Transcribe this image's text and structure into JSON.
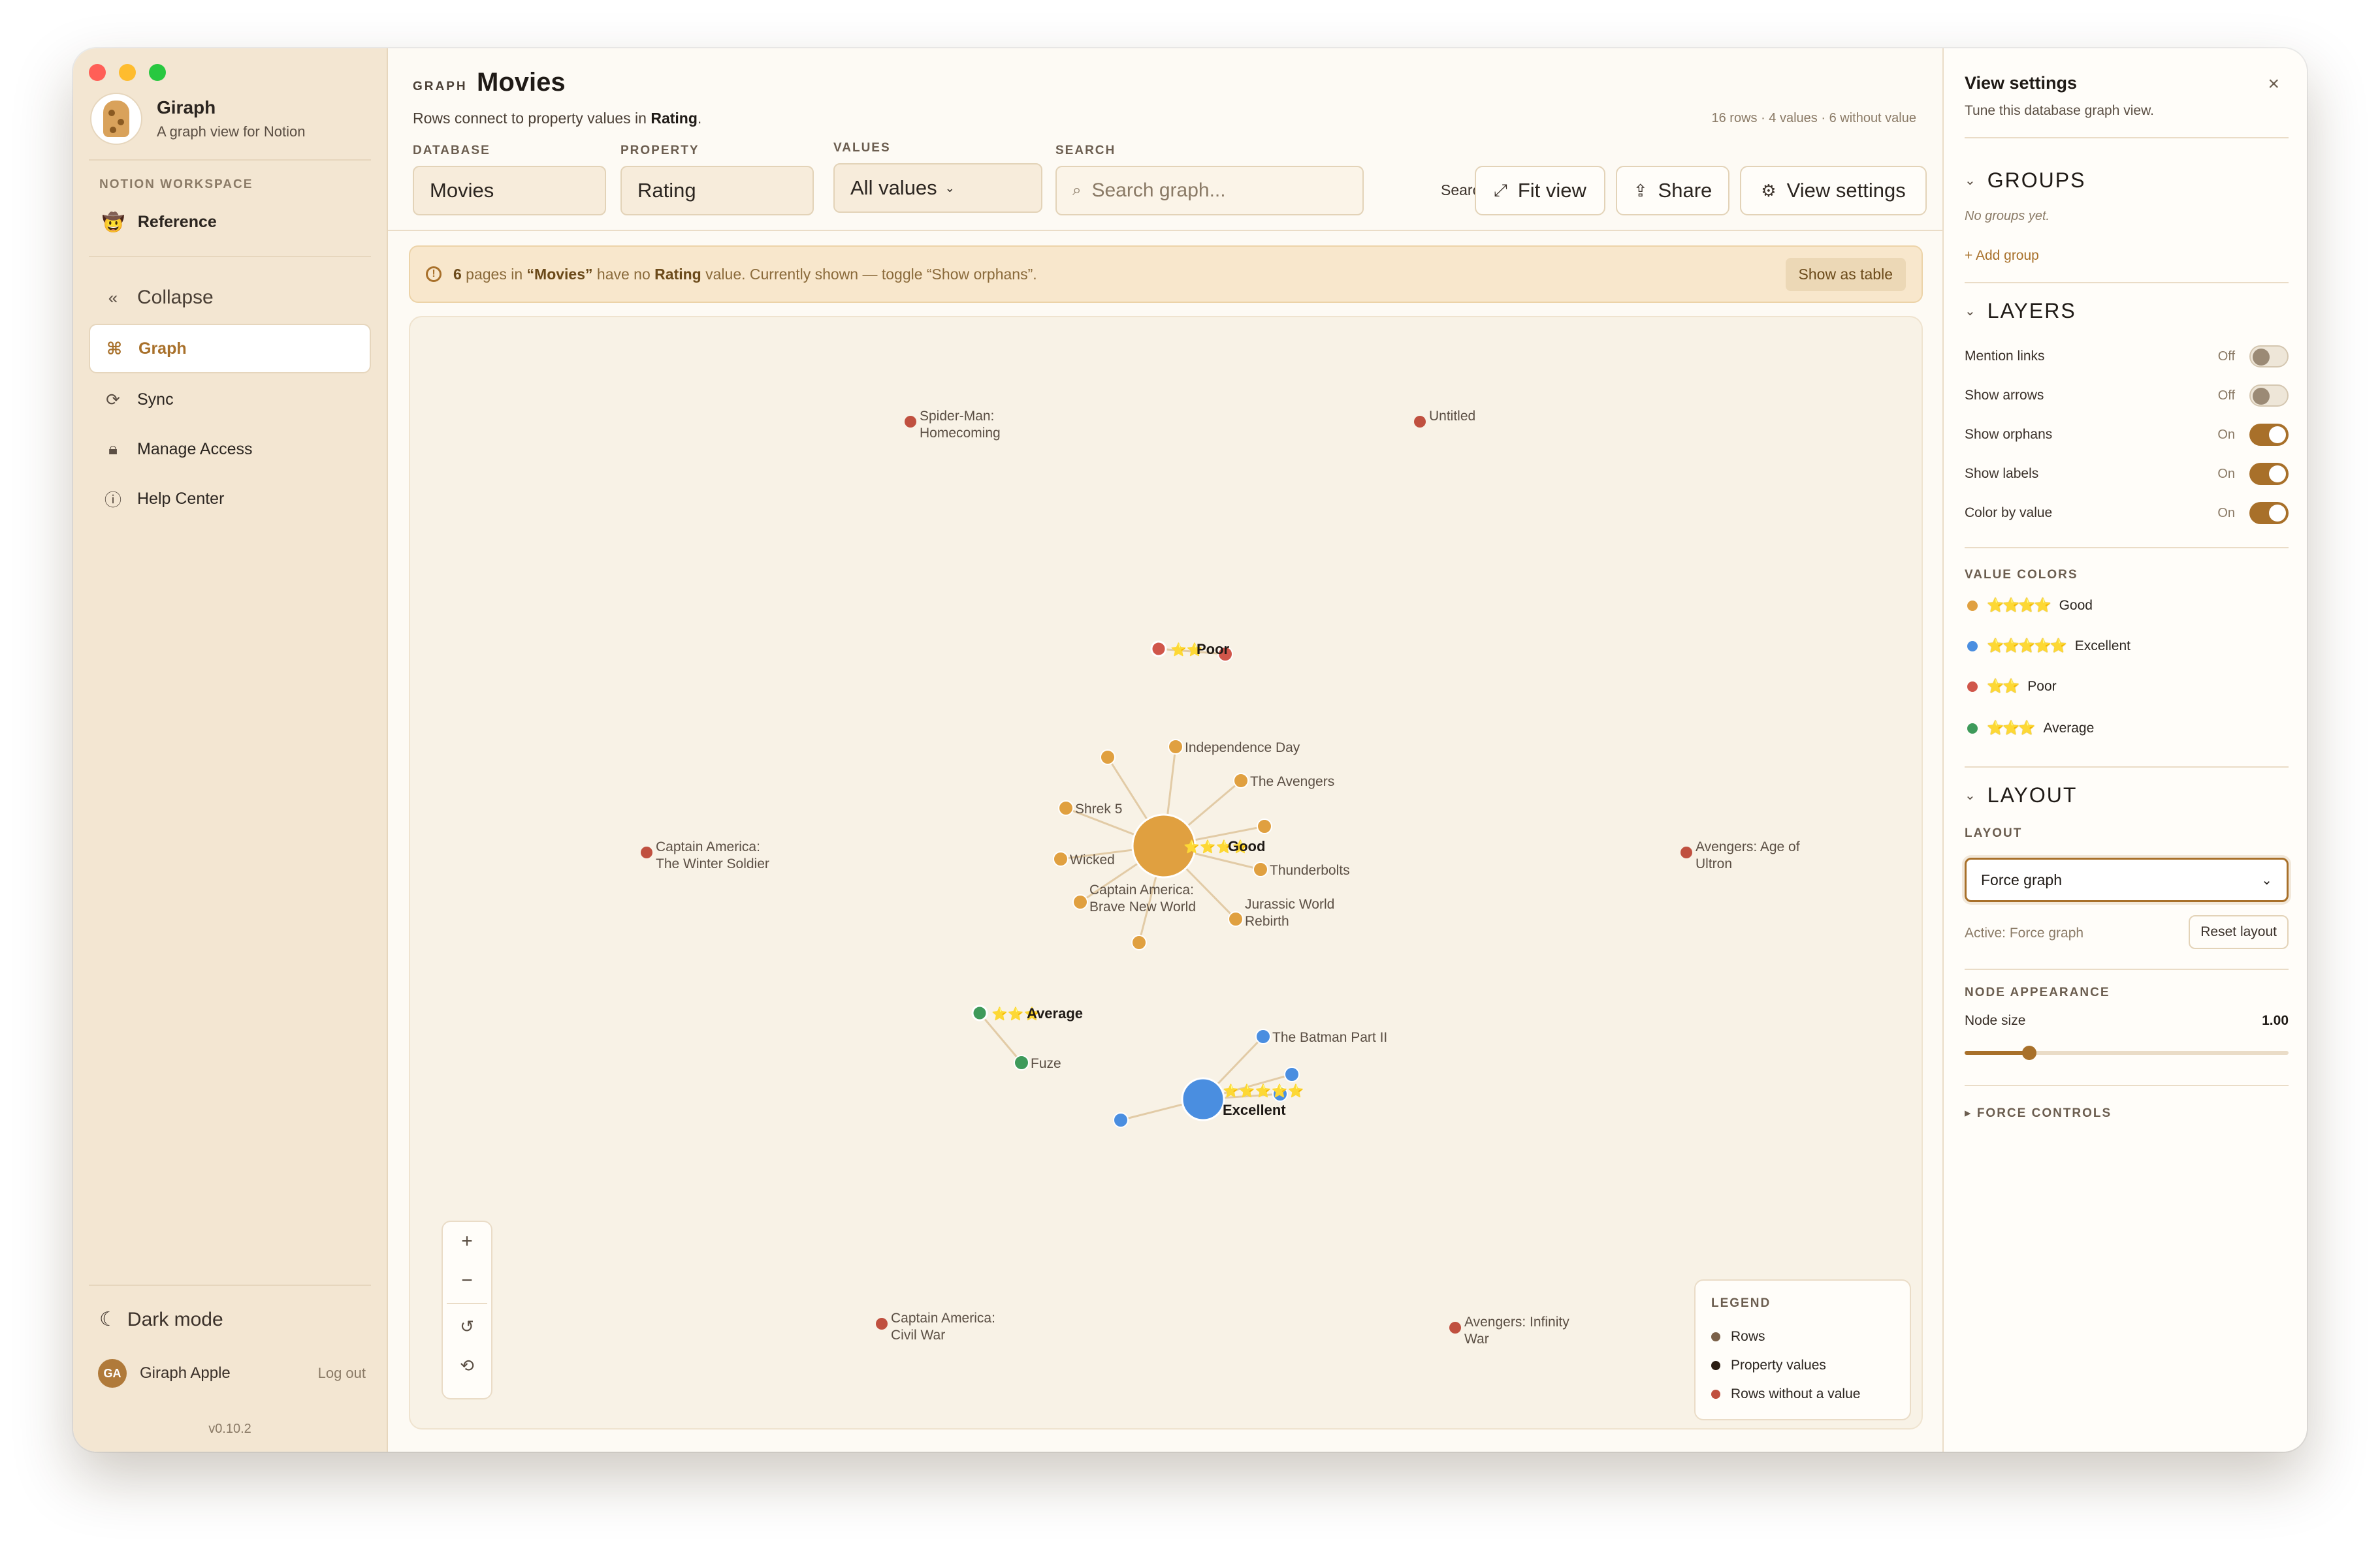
{
  "sidebar": {
    "brand_name": "Giraph",
    "brand_subtitle": "A graph view for Notion",
    "workspace_label": "NOTION WORKSPACE",
    "workspace_item": "Reference",
    "workspace_emoji": "🤠",
    "collapse_label": "Collapse",
    "items": [
      {
        "label": "Graph",
        "icon": "graph-icon",
        "glyph": "⌘",
        "active": true
      },
      {
        "label": "Sync",
        "icon": "sync-icon",
        "glyph": "⟳",
        "active": false
      },
      {
        "label": "Manage Access",
        "icon": "lock-icon",
        "glyph": "🔒︎",
        "active": false
      },
      {
        "label": "Help Center",
        "icon": "help-icon",
        "glyph": "ⓘ",
        "active": false
      }
    ],
    "dark_mode_label": "Dark mode",
    "user_initials": "GA",
    "user_name": "Giraph Apple",
    "logout_label": "Log out",
    "version": "v0.10.2"
  },
  "header": {
    "eyebrow": "GRAPH",
    "title": "Movies",
    "subtitle_prefix": "Rows connect to property values in ",
    "subtitle_property": "Rating",
    "subtitle_suffix": ".",
    "stats": "16 rows · 4 values · 6 without value",
    "database_label": "DATABASE",
    "database_value": "Movies",
    "property_label": "PROPERTY",
    "property_value": "Rating",
    "values_label": "VALUES",
    "values_value": "All values",
    "search_label": "SEARCH",
    "search_placeholder": "Search graph...",
    "search_hint": "Search",
    "search_kbd": "/",
    "fit_view": "Fit view",
    "share": "Share",
    "view_settings": "View settings"
  },
  "banner": {
    "count": "6",
    "text_a": " pages in ",
    "db": "“Movies”",
    "text_b": " have no ",
    "prop": "Rating",
    "text_c": " value. Currently shown — toggle “Show orphans”.",
    "button": "Show as table"
  },
  "graph": {
    "colors": {
      "good": "#e0a040",
      "excellent": "#4a8ee0",
      "poor": "#d0564a",
      "average": "#3e9a5a",
      "orphan": "#c0503f",
      "edge": "#e2cba6"
    },
    "value_nodes": [
      {
        "id": "good",
        "label": "Good",
        "stars": "⭐⭐⭐⭐"
      },
      {
        "id": "excellent",
        "label": "Excellent",
        "stars": "⭐⭐⭐⭐⭐"
      },
      {
        "id": "poor",
        "label": "Poor",
        "stars": "⭐⭐"
      },
      {
        "id": "average",
        "label": "Average",
        "stars": "⭐⭐⭐"
      }
    ],
    "row_nodes": [
      {
        "label": "Independence Day",
        "value": "good"
      },
      {
        "label": "The Avengers",
        "value": "good"
      },
      {
        "label": "Shrek 5",
        "value": "good"
      },
      {
        "label": "Wicked",
        "value": "good"
      },
      {
        "label": "Thunderbolts",
        "value": "good"
      },
      {
        "label": "Captain America:\nBrave New World",
        "value": "good"
      },
      {
        "label": "Jurassic World\nRebirth",
        "value": "good"
      },
      {
        "label": "",
        "value": "good"
      },
      {
        "label": "",
        "value": "good"
      },
      {
        "label": "",
        "value": "good"
      },
      {
        "label": "Fuze",
        "value": "average"
      },
      {
        "label": "The Batman Part II",
        "value": "excellent"
      },
      {
        "label": "",
        "value": "excellent"
      },
      {
        "label": "",
        "value": "excellent"
      },
      {
        "label": "",
        "value": "excellent"
      },
      {
        "label": "",
        "value": "poor"
      }
    ],
    "orphans": [
      {
        "label": "Spider-Man:\nHomecoming"
      },
      {
        "label": "Untitled"
      },
      {
        "label": "Captain America:\nThe Winter Soldier"
      },
      {
        "label": "Avengers: Age of\nUltron"
      },
      {
        "label": "Captain America:\nCivil War"
      },
      {
        "label": "Avengers: Infinity\nWar"
      }
    ]
  },
  "legend": {
    "title": "LEGEND",
    "items": [
      {
        "label": "Rows",
        "color": "#7a6048"
      },
      {
        "label": "Property values",
        "color": "#2b1d12"
      },
      {
        "label": "Rows without a value",
        "color": "#c0503f"
      }
    ]
  },
  "zoom": {
    "zoom_in": "+",
    "zoom_out": "−",
    "reset": "↺",
    "history": "⟲"
  },
  "panel": {
    "title": "View settings",
    "subtitle": "Tune this database graph view.",
    "close": "×",
    "groups_title": "GROUPS",
    "groups_empty": "No groups yet.",
    "add_group": "+ Add group",
    "layers_title": "LAYERS",
    "layers": [
      {
        "label": "Mention links",
        "state": "Off",
        "on": false
      },
      {
        "label": "Show arrows",
        "state": "Off",
        "on": false
      },
      {
        "label": "Show orphans",
        "state": "On",
        "on": true
      },
      {
        "label": "Show labels",
        "state": "On",
        "on": true
      },
      {
        "label": "Color by value",
        "state": "On",
        "on": true
      }
    ],
    "value_colors_title": "VALUE COLORS",
    "value_colors": [
      {
        "stars": "⭐⭐⭐⭐",
        "label": "Good",
        "color": "#e0a040"
      },
      {
        "stars": "⭐⭐⭐⭐⭐",
        "label": "Excellent",
        "color": "#4a8ee0"
      },
      {
        "stars": "⭐⭐",
        "label": "Poor",
        "color": "#d0564a"
      },
      {
        "stars": "⭐⭐⭐",
        "label": "Average",
        "color": "#3e9a5a"
      }
    ],
    "layout_title": "LAYOUT",
    "layout_caption": "LAYOUT",
    "layout_value": "Force graph",
    "layout_active": "Active: Force graph",
    "reset_layout": "Reset layout",
    "node_appearance": "NODE APPEARANCE",
    "node_size_label": "Node size",
    "node_size_value": "1.00",
    "node_size_fraction": 0.2,
    "force_controls": "▸ FORCE CONTROLS"
  }
}
